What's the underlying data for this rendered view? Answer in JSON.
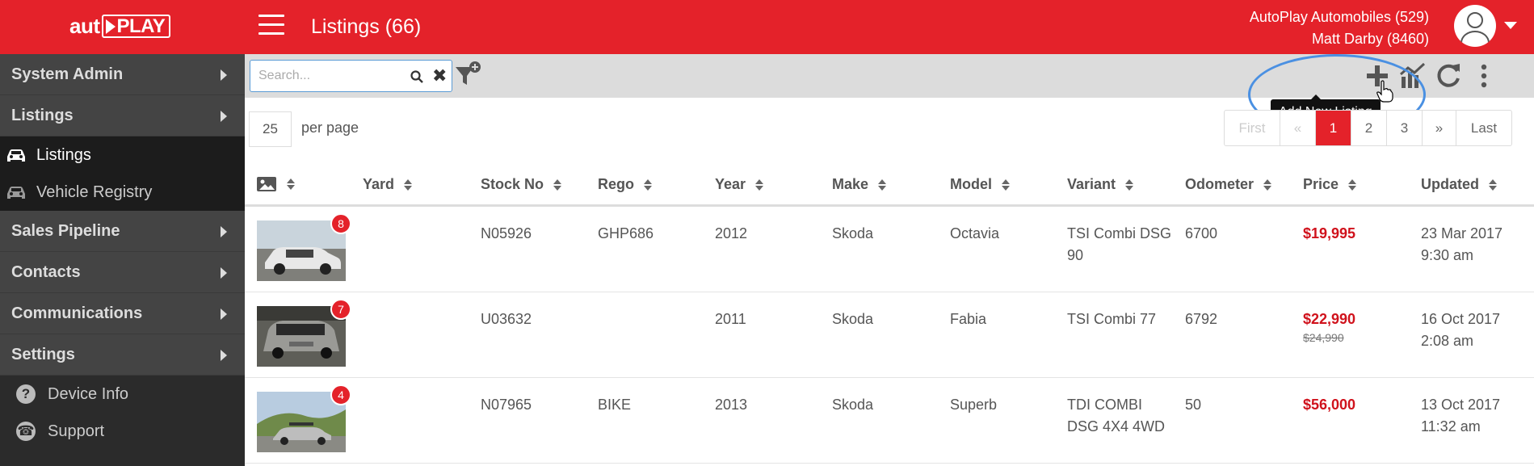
{
  "header": {
    "logo_text_left": "aut",
    "logo_text_right": "PLAY",
    "title": "Listings (66)",
    "account_line1": "AutoPlay Automobiles (529)",
    "account_line2": "Matt Darby (8460)"
  },
  "sidebar": {
    "groups": [
      {
        "label": "System Admin"
      },
      {
        "label": "Listings"
      }
    ],
    "listings_sub": [
      {
        "label": "Listings",
        "icon": "car-icon"
      },
      {
        "label": "Vehicle Registry",
        "icon": "car-icon"
      }
    ],
    "groups2": [
      {
        "label": "Sales Pipeline"
      },
      {
        "label": "Contacts"
      },
      {
        "label": "Communications"
      },
      {
        "label": "Settings"
      }
    ],
    "utils": [
      {
        "label": "Device Info",
        "icon": "question-circle-icon"
      },
      {
        "label": "Support",
        "icon": "support-icon"
      }
    ]
  },
  "toolbar": {
    "search_placeholder": "Search...",
    "tooltip": "Add New Listing"
  },
  "pagination": {
    "per_page": "25",
    "per_page_label": "per page",
    "first": "First",
    "prev": "«",
    "pages": [
      "1",
      "2",
      "3"
    ],
    "current": "1",
    "next": "»",
    "last": "Last"
  },
  "table": {
    "columns": [
      "Yard",
      "Stock No",
      "Rego",
      "Year",
      "Make",
      "Model",
      "Variant",
      "Odometer",
      "Price",
      "Updated"
    ],
    "rows": [
      {
        "photos": "8",
        "yard": "",
        "stock": "N05926",
        "rego": "GHP686",
        "year": "2012",
        "make": "Skoda",
        "model": "Octavia",
        "variant_1": "TSI Combi DSG",
        "variant_2": "90",
        "odometer": "6700",
        "price": "$19,995",
        "was": "",
        "updated_1": "23 Mar 2017",
        "updated_2": "9:30 am",
        "car_color": "#e8e8e8"
      },
      {
        "photos": "7",
        "yard": "",
        "stock": "U03632",
        "rego": "",
        "year": "2011",
        "make": "Skoda",
        "model": "Fabia",
        "variant_1": "TSI Combi 77",
        "variant_2": "",
        "odometer": "6792",
        "price": "$22,990",
        "was": "$24,990",
        "updated_1": "16 Oct 2017",
        "updated_2": "2:08 am",
        "car_color": "#9a9a96"
      },
      {
        "photos": "4",
        "yard": "",
        "stock": "N07965",
        "rego": "BIKE",
        "year": "2013",
        "make": "Skoda",
        "model": "Superb",
        "variant_1": "TDI COMBI",
        "variant_2": "DSG 4X4 4WD",
        "odometer": "50",
        "price": "$56,000",
        "was": "",
        "updated_1": "13 Oct 2017",
        "updated_2": "11:32 am",
        "car_color": "#bdbdbd"
      }
    ]
  }
}
